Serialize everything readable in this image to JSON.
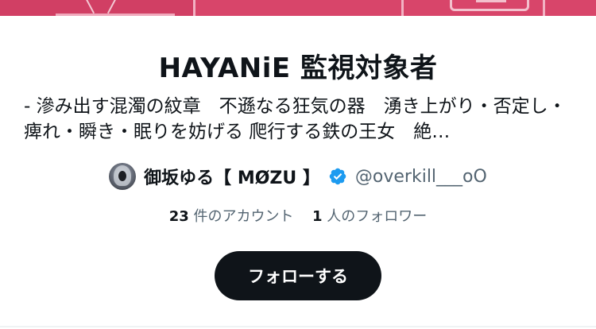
{
  "list": {
    "title": "HAYANiE 監視対象者",
    "description": "‑ 滲み出す混濁の紋章　不遜なる狂気の器　湧き上がり・否定し・痺れ・瞬き・眠りを妨げる 爬行する鉄の王女　絶…",
    "owner": {
      "display_name": "御坂ゆる【 MØZU 】",
      "handle": "@overkill___oO",
      "verified": true,
      "avatar_icon": "avatar-image"
    },
    "stats": {
      "members_count": "23",
      "members_label": "件のアカウント",
      "followers_count": "1",
      "followers_label": "人のフォロワー"
    },
    "follow_button_label": "フォローする"
  },
  "colors": {
    "banner": "#d8456a",
    "text_primary": "#0f1419",
    "text_secondary": "#536471",
    "verified_blue": "#1d9bf0",
    "button_bg": "#0f1419",
    "button_text": "#ffffff"
  }
}
